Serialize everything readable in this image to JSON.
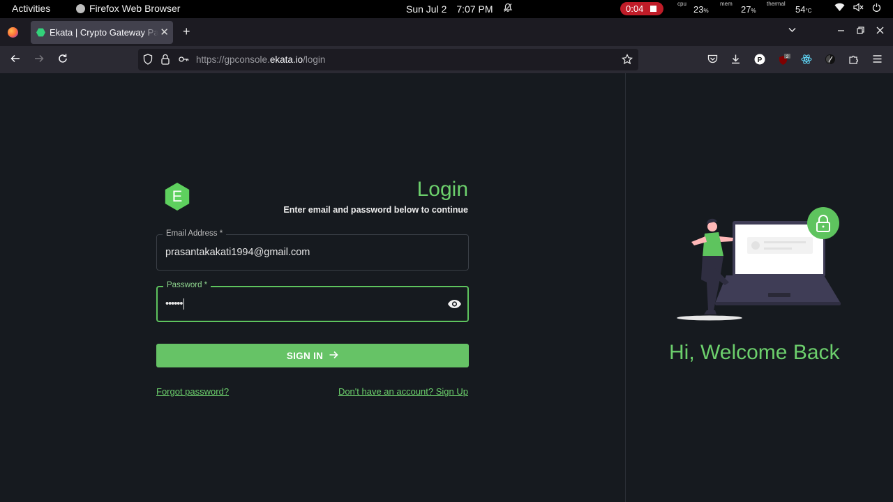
{
  "topbar": {
    "activities": "Activities",
    "app_name": "Firefox Web Browser",
    "date": "Sun Jul 2",
    "time": "7:07 PM",
    "recording_time": "0:04",
    "cpu_label": "cpu",
    "cpu_value": "23",
    "mem_label": "mem",
    "mem_value": "27",
    "thermal_label": "thermal",
    "thermal_value": "54",
    "percent_unit": "%",
    "temp_unit": "°C"
  },
  "browser": {
    "tab_title": "Ekata | Crypto Gateway Payment",
    "url_prefix": "https://gpconsole.",
    "url_domain": "ekata.io",
    "url_path": "/login",
    "notification_count": "2"
  },
  "login": {
    "logo_letter": "E",
    "title": "Login",
    "subtitle": "Enter email and password below to continue",
    "email_label": "Email Address *",
    "email_value": "prasantakakati1994@gmail.com",
    "password_label": "Password *",
    "password_value": "••••••",
    "signin_label": "SIGN IN",
    "forgot_label": "Forgot password?",
    "signup_label": "Don't have an account? Sign Up"
  },
  "welcome": {
    "text": "Hi, Welcome Back"
  },
  "colors": {
    "accent": "#66c366",
    "background": "#161a1f",
    "record": "#c01c28"
  }
}
